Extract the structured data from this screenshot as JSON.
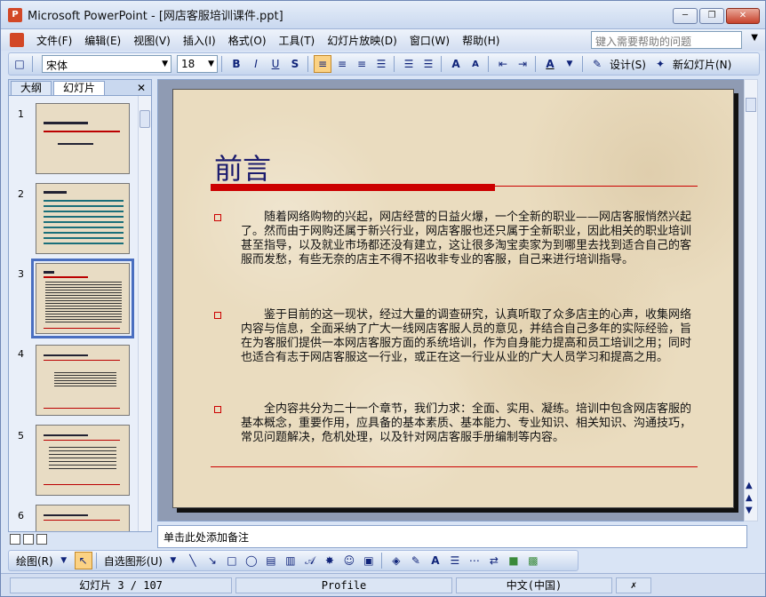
{
  "window": {
    "title": "Microsoft PowerPoint - [网店客服培训课件.ppt]",
    "app_icon": "powerpoint-icon"
  },
  "menubar": {
    "items": [
      "文件(F)",
      "编辑(E)",
      "视图(V)",
      "插入(I)",
      "格式(O)",
      "工具(T)",
      "幻灯片放映(D)",
      "窗口(W)",
      "帮助(H)"
    ],
    "help_placeholder": "键入需要帮助的问题"
  },
  "toolbar": {
    "font_name": "宋体",
    "font_size": "18",
    "bold": "B",
    "italic": "I",
    "underline": "U",
    "shadow": "S",
    "font_grow": "A",
    "font_shrink": "A",
    "font_color": "A",
    "design_label": "设计(S)",
    "new_slide_label": "新幻灯片(N)"
  },
  "left_pane": {
    "tabs": [
      "大纲",
      "幻灯片"
    ],
    "active_tab": "幻灯片",
    "slide_numbers": [
      "1",
      "2",
      "3",
      "4",
      "5",
      "6"
    ],
    "selected_slide": "3"
  },
  "slide": {
    "title": "前言",
    "paragraphs": [
      "随着网络购物的兴起，网店经营的日益火爆，一个全新的职业——网店客服悄然兴起了。然而由于网购还属于新兴行业，网店客服也还只属于全新职业，因此相关的职业培训甚至指导，以及就业市场都还没有建立，这让很多淘宝卖家为到哪里去找到适合自己的客服而发愁，有些无奈的店主不得不招收非专业的客服，自己来进行培训指导。",
      "鉴于目前的这一现状，经过大量的调查研究，认真听取了众多店主的心声，收集网络内容与信息，全面采纳了广大一线网店客服人员的意见，并结合自己多年的实际经验，旨在为客服们提供一本网店客服方面的系统培训，作为自身能力提高和员工培训之用；同时也适合有志于网店客服这一行业，或正在这一行业从业的广大人员学习和提高之用。",
      "全内容共分为二十一个章节，我们力求：全面、实用、凝练。培训中包含网店客服的基本概念，重要作用，应具备的基本素质、基本能力、专业知识、相关知识、沟通技巧，常见问题解决，危机处理，以及针对网店客服手册编制等内容。"
    ],
    "accent_color": "#cc0000",
    "title_color": "#1c1c6e"
  },
  "notes": {
    "placeholder": "单击此处添加备注"
  },
  "drawbar": {
    "draw_label": "绘图(R)",
    "autoshapes_label": "自选图形(U)"
  },
  "statusbar": {
    "slide_info": "幻灯片 3 / 107",
    "design": "Profile",
    "language": "中文(中国)"
  }
}
